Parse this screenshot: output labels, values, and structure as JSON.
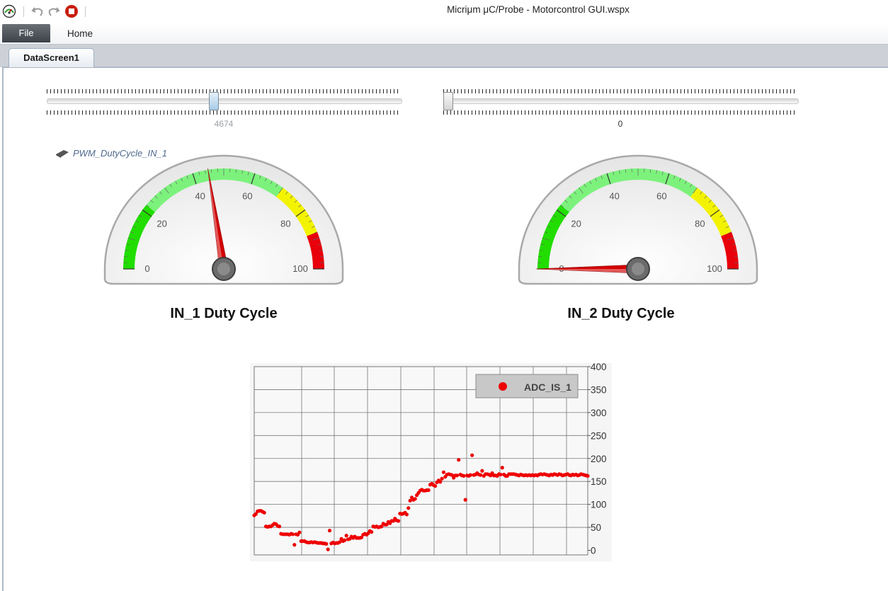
{
  "window": {
    "title": "Micriμm μC/Probe - Motorcontrol GUI.wspx"
  },
  "quick_access": {
    "icons": [
      "probe-logo-icon",
      "undo-icon",
      "redo-icon",
      "stop-icon"
    ]
  },
  "ribbon": {
    "file_label": "File",
    "home_label": "Home"
  },
  "tabs": {
    "active_label": "DataScreen1"
  },
  "sliders": [
    {
      "value_label": "4674",
      "position_fraction": 0.47,
      "value_color": "#9aa0a6"
    },
    {
      "value_label": "0",
      "position_fraction": 0.0,
      "value_color": "#333333"
    }
  ],
  "gauges": [
    {
      "title": "IN_1 Duty Cycle",
      "variable_label": "PWM_DutyCycle_IN_1",
      "value": 45,
      "min": 0,
      "max": 100,
      "tick_labels": [
        "0",
        "20",
        "40",
        "60",
        "80",
        "100"
      ],
      "ranges": [
        {
          "from": 0,
          "to": 22,
          "color": "#22dd00"
        },
        {
          "from": 22,
          "to": 70,
          "color": "#7cf27c"
        },
        {
          "from": 70,
          "to": 88,
          "color": "#f3f300"
        },
        {
          "from": 88,
          "to": 100,
          "color": "#e8000a"
        }
      ]
    },
    {
      "title": "IN_2 Duty Cycle",
      "value": 0,
      "min": 0,
      "max": 100,
      "tick_labels": [
        "0",
        "20",
        "40",
        "60",
        "80",
        "100"
      ],
      "ranges": [
        {
          "from": 0,
          "to": 22,
          "color": "#22dd00"
        },
        {
          "from": 22,
          "to": 70,
          "color": "#7cf27c"
        },
        {
          "from": 70,
          "to": 88,
          "color": "#f3f300"
        },
        {
          "from": 88,
          "to": 100,
          "color": "#e8000a"
        }
      ]
    }
  ],
  "chart_data": {
    "type": "scatter",
    "series": [
      {
        "name": "ADC_IS_1",
        "color": "#ee0000",
        "x": [
          0,
          1,
          2,
          3,
          4,
          5,
          6,
          7,
          8,
          9,
          10,
          11,
          12,
          13,
          14,
          15,
          16,
          17,
          18,
          19,
          20,
          21,
          22,
          23,
          24,
          25,
          26,
          27,
          28,
          29,
          30,
          31,
          32,
          33,
          34,
          35,
          36,
          37,
          38,
          39,
          40,
          41,
          42,
          43,
          44,
          45,
          46,
          47,
          48,
          49,
          50,
          51,
          52,
          53,
          54,
          55,
          56,
          57,
          58,
          59,
          60,
          61,
          62,
          63,
          64,
          65,
          66,
          67,
          68,
          69,
          70,
          71,
          72,
          73,
          74,
          75,
          76,
          77,
          78,
          79,
          80,
          81,
          82,
          83,
          84,
          85,
          86,
          87,
          88,
          89,
          90,
          91,
          92,
          93,
          94,
          95,
          96,
          97,
          98,
          99,
          100,
          101,
          102,
          103,
          104,
          105,
          106,
          107,
          108,
          109,
          110,
          111,
          112,
          113,
          114,
          115,
          116,
          117,
          118,
          119,
          120,
          121,
          122,
          123,
          124,
          125,
          126,
          127,
          128,
          129,
          130,
          131,
          132,
          133,
          134,
          135,
          136,
          137,
          138,
          139,
          140,
          141,
          142,
          143,
          144,
          145,
          146,
          147,
          148,
          149,
          150,
          151,
          152,
          153,
          154,
          155,
          156,
          157,
          158,
          159,
          160,
          161,
          162,
          163,
          164,
          165,
          166,
          167,
          168,
          169,
          170,
          171,
          172,
          173,
          174,
          175,
          176,
          177,
          178,
          179,
          180,
          181,
          182,
          183,
          184,
          185,
          186,
          187,
          188,
          189,
          190,
          191,
          192,
          193,
          194,
          195,
          196,
          197,
          198,
          199
        ],
        "y": [
          76,
          79,
          85,
          86,
          86,
          84,
          82,
          52,
          51,
          52,
          52,
          55,
          58,
          57,
          53,
          52,
          36,
          35,
          35,
          35,
          35,
          34,
          36,
          35,
          12,
          35,
          34,
          39,
          20,
          20,
          20,
          18,
          17,
          17,
          18,
          17,
          18,
          17,
          16,
          16,
          16,
          15,
          15,
          14,
          2,
          43,
          15,
          17,
          15,
          16,
          16,
          18,
          25,
          20,
          22,
          32,
          24,
          25,
          30,
          27,
          30,
          27,
          27,
          27,
          28,
          34,
          36,
          34,
          37,
          42,
          40,
          52,
          51,
          52,
          50,
          51,
          52,
          58,
          56,
          56,
          62,
          59,
          64,
          64,
          69,
          65,
          64,
          80,
          79,
          80,
          82,
          78,
          92,
          108,
          115,
          110,
          112,
          120,
          125,
          130,
          132,
          130,
          130,
          131,
          131,
          143,
          145,
          142,
          140,
          148,
          152,
          149,
          156,
          170,
          160,
          165,
          166,
          165,
          164,
          158,
          163,
          163,
          197,
          165,
          163,
          162,
          110,
          163,
          162,
          164,
          207,
          164,
          165,
          168,
          165,
          164,
          173,
          162,
          166,
          166,
          165,
          163,
          168,
          163,
          163,
          162,
          166,
          165,
          180,
          165,
          162,
          162,
          166,
          166,
          166,
          166,
          165,
          164,
          163,
          165,
          164,
          163,
          164,
          163,
          164,
          163,
          164,
          163,
          164,
          163,
          165,
          166,
          165,
          166,
          165,
          164,
          163,
          165,
          164,
          166,
          165,
          164,
          166,
          165,
          163,
          164,
          165,
          166,
          164,
          163,
          165,
          164,
          165,
          163,
          164,
          166,
          165,
          164,
          163,
          162
        ]
      }
    ],
    "ylim": [
      -10,
      400
    ],
    "y_ticks": [
      0,
      50,
      100,
      150,
      200,
      250,
      300,
      350,
      400
    ],
    "grid": true,
    "legend_position": "top-right"
  }
}
